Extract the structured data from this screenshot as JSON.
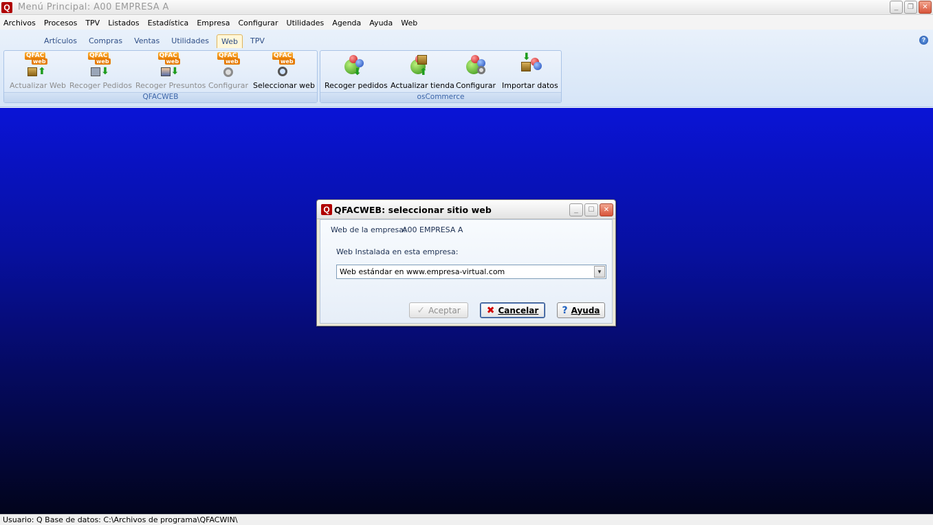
{
  "window": {
    "title": "Menú Principal: A00  EMPRESA A",
    "logo": "Q"
  },
  "menu": [
    "Archivos",
    "Procesos",
    "TPV",
    "Listados",
    "Estadística",
    "Empresa",
    "Configurar",
    "Utilidades",
    "Agenda",
    "Ayuda",
    "Web"
  ],
  "ribbon": {
    "tabs": [
      "Artículos",
      "Compras",
      "Ventas",
      "Utilidades",
      "Web",
      "TPV"
    ],
    "active_tab": "Web",
    "groups": {
      "qfacweb": {
        "label": "QFACWEB",
        "icon_badge_top": "QFAC",
        "icon_badge_sub": "web",
        "buttons": [
          "Actualizar Web",
          "Recoger Pedidos",
          "Recoger Presuntos",
          "Configurar",
          "Seleccionar web"
        ]
      },
      "oscommerce": {
        "label": "osCommerce",
        "buttons": [
          "Recoger pedidos",
          "Actualizar tienda",
          "Configurar",
          "Importar datos"
        ]
      }
    }
  },
  "dialog": {
    "title": "QFACWEB: seleccionar sitio web",
    "logo": "Q",
    "company_label": "Web de la empresa:",
    "company_value": "A00 EMPRESA A",
    "installed_label": "Web Instalada en esta empresa:",
    "selected_site": "Web estándar en www.empresa-virtual.com",
    "buttons": {
      "accept": "Aceptar",
      "cancel": "Cancelar",
      "help": "Ayuda"
    }
  },
  "statusbar": {
    "text": "Usuario: Q  Base de datos: C:\\Archivos de programa\\QFACWIN\\"
  },
  "colors": {
    "desktop_top": "#0a14d6",
    "desktop_bottom": "#02041c",
    "ribbon_text": "#2f4e86"
  }
}
